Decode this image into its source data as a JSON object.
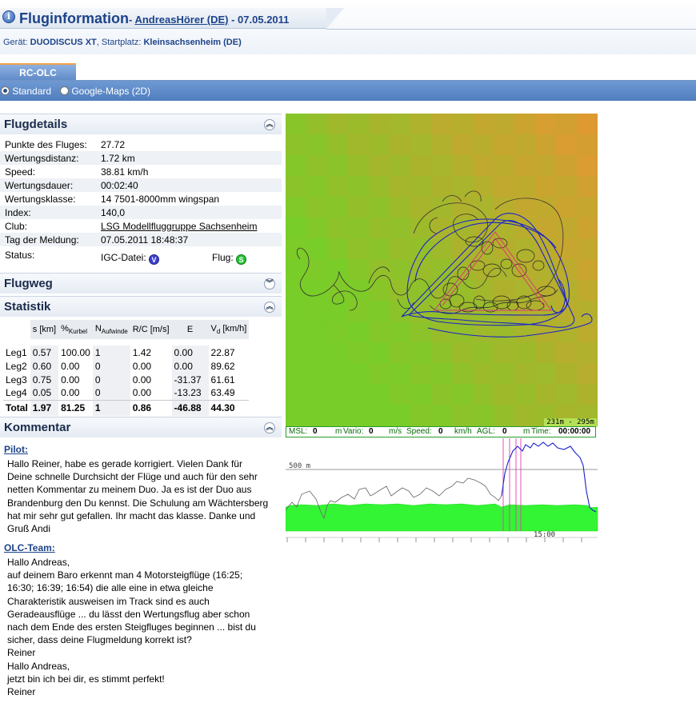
{
  "header": {
    "title": "Fluginformation",
    "separator": "- ",
    "pilot": "AndreasHörer (DE)",
    "date_separator": " - ",
    "date": "07.05.2011",
    "device_label": "Gerät:",
    "device": "DUODISCUS XT",
    "start_label": "Startplatz:",
    "start": "Kleinsachsenheim (DE)"
  },
  "tabs": [
    {
      "label": "RC-OLC",
      "active": true
    }
  ],
  "view_options": [
    {
      "label": "Standard",
      "selected": true
    },
    {
      "label": "Google-Maps (2D)",
      "selected": false
    }
  ],
  "sections": {
    "flugdetails": "Flugdetails",
    "flugweg": "Flugweg",
    "statistik": "Statistik",
    "kommentar": "Kommentar"
  },
  "details": [
    {
      "key": "Punkte des Fluges:",
      "value": "27.72"
    },
    {
      "key": "Wertungsdistanz:",
      "value": "1.72 km"
    },
    {
      "key": "Speed:",
      "value": "38.81 km/h"
    },
    {
      "key": "Wertungsdauer:",
      "value": "00:02:40"
    },
    {
      "key": "Wertungsklasse:",
      "value": "14 7501-8000mm wingspan"
    },
    {
      "key": "Index:",
      "value": "140,0"
    },
    {
      "key": "Club:",
      "value": "LSG Modellfluggruppe Sachsenheim"
    },
    {
      "key": "Tag der Meldung:",
      "value": "07.05.2011 18:48:37"
    }
  ],
  "status": {
    "label": "Status:",
    "igc_label": "IGC-Datei:",
    "igc_badge": "V",
    "flug_label": "Flug:",
    "flug_badge": "S"
  },
  "statistics": {
    "headers": {
      "s": "s [km]",
      "kurbel": "%",
      "kurbel_sub": "Kurbel",
      "aufwinde": "N",
      "aufwinde_sub": "Aufwinde",
      "rc": "R/C [m/s]",
      "e": "E",
      "vd": "V",
      "vd_sub": "d",
      "vd_unit": " [km/h]"
    },
    "rows": [
      {
        "name": "Leg1",
        "s": "0.57",
        "kurbel": "100.00",
        "aufwinde": "1",
        "rc": "1.42",
        "e": "0.00",
        "vd": "22.87"
      },
      {
        "name": "Leg2",
        "s": "0.60",
        "kurbel": "0.00",
        "aufwinde": "0",
        "rc": "0.00",
        "e": "0.00",
        "vd": "89.62"
      },
      {
        "name": "Leg3",
        "s": "0.75",
        "kurbel": "0.00",
        "aufwinde": "0",
        "rc": "0.00",
        "e": "-31.37",
        "vd": "61.61"
      },
      {
        "name": "Leg4",
        "s": "0.05",
        "kurbel": "0.00",
        "aufwinde": "0",
        "rc": "0.00",
        "e": "-13.23",
        "vd": "63.49"
      }
    ],
    "total": {
      "name": "Total",
      "s": "1.97",
      "kurbel": "81.25",
      "aufwinde": "1",
      "rc": "0.86",
      "e": "-46.88",
      "vd": "44.30"
    }
  },
  "comments": {
    "pilot_label": "Pilot:",
    "pilot_text": "Hallo Reiner, habe es gerade korrigiert. Vielen Dank für\nDeine schnelle Durchsicht der Flüge und auch für den sehr\nnetten Kommentar zu meinem Duo. Ja es ist der Duo aus\nBrandenburg den Du kennst. Die Schulung am Wächtersberg\nhat mir sehr gut gefallen. Ihr macht das klasse. Danke und\nGruß Andi",
    "team_label": "OLC-Team:",
    "team_text": "Hallo Andreas,\nauf deinem Baro erkennt man 4 Motorsteigflüge (16:25;\n16:30; 16:39; 16:54) die alle eine in etwa gleiche\nCharakteristik ausweisen im Track sind es auch\nGeradeausflüge ... du lässt den Wertungsflug aber schon\nnach dem Ende des ersten Steigfluges beginnen ... bist du\nsicher, dass deine Flugmeldung korrekt ist?\nReiner\nHallo Andreas,\njetzt bin ich bei dir, es stimmt perfekt!\nReiner"
  },
  "map": {
    "scale_text": "231m - 295m"
  },
  "readout": {
    "msl_label": "MSL:",
    "msl": "0",
    "msl_unit": "m",
    "vario_label": "Vario:",
    "vario": "0",
    "vario_unit": "m/s",
    "speed_label": "Speed:",
    "speed": "0",
    "speed_unit": "km/h",
    "agl_label": "AGL:",
    "agl": "0",
    "agl_unit": "m",
    "time_label": "Time:",
    "time": "00:00:00"
  },
  "baro": {
    "level_label": "500 m",
    "time_label": "15:00"
  },
  "colors": {
    "title_blue": "#1d4389",
    "bar_blue": "#5c88c6",
    "terrain_green": "#33f533",
    "track_blue": "#1a22c8",
    "task_red": "#e0307a"
  }
}
